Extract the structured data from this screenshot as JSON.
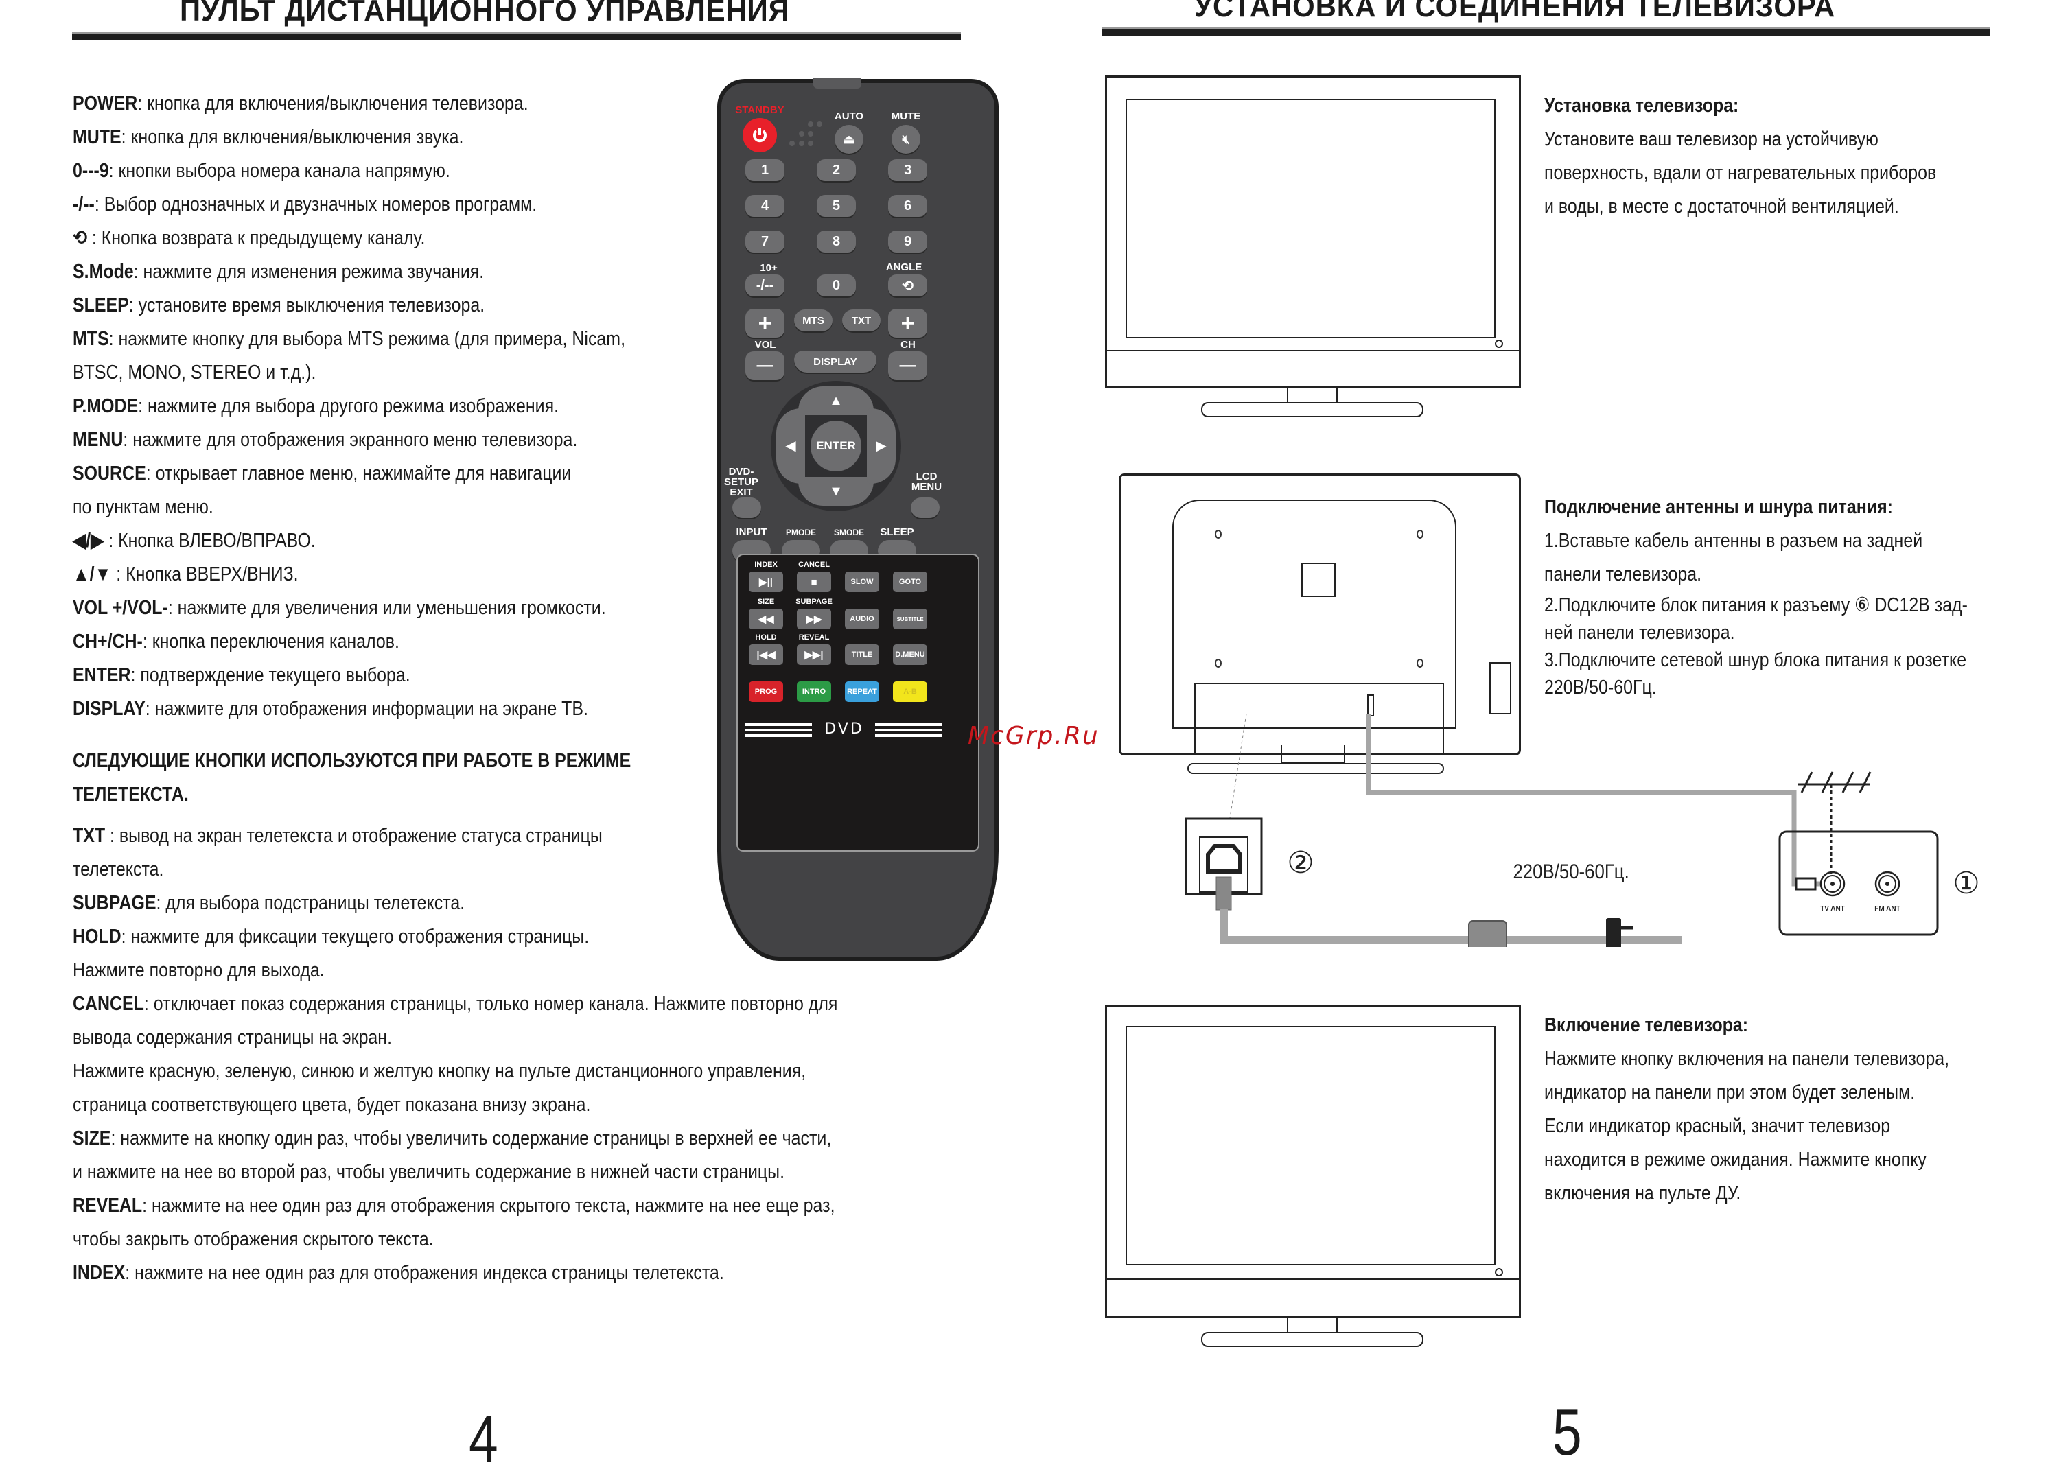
{
  "left_page": {
    "heading": "ПУЛЬТ ДИСТАНЦИОННОГО УПРАВЛЕНИЯ",
    "descriptions": [
      {
        "key": "POWER",
        "text": ": кнопка для включения/выключения телевизора."
      },
      {
        "key": "MUTE",
        "text": ": кнопка для включения/выключения звука."
      },
      {
        "key": "0---9",
        "text": ": кнопки выбора номера канала напрямую."
      },
      {
        "key": "-/--",
        "text": ": Выбор однозначных и двузначных номеров программ."
      },
      {
        "key": "⟲",
        "text": " : Кнопка возврата к предыдущему каналу."
      },
      {
        "key": "S.Mode",
        "text": ": нажмите для изменения режима звучания."
      },
      {
        "key": "SLEEP",
        "text": ": установите время выключения телевизора."
      },
      {
        "key": "MTS",
        "text": ": нажмите кнопку для выбора MTS режима (для примера, Nicam,"
      },
      {
        "key": "",
        "text": "BTSC, MONO, STEREO и т.д.)."
      },
      {
        "key": "P.MODE",
        "text": ": нажмите для выбора другого режима изображения."
      },
      {
        "key": "MENU",
        "text": ": нажмите для отображения экранного меню телевизора."
      },
      {
        "key": "SOURCE",
        "text": ": открывает главное меню, нажимайте для навигации"
      },
      {
        "key": "",
        "text": "по пунктам меню."
      },
      {
        "key": "◀/▶",
        "text": " : Кнопка ВЛЕВО/ВПРАВО."
      },
      {
        "key": "▲/▼",
        "text": " : Кнопка ВВЕРХ/ВНИЗ."
      },
      {
        "key": "VOL +/VOL-",
        "text": ": нажмите для увеличения или уменьшения громкости."
      },
      {
        "key": "CH+/CH-",
        "text": ": кнопка переключения каналов."
      },
      {
        "key": "ENTER",
        "text": ": подтверждение текущего выбора."
      },
      {
        "key": "DISPLAY",
        "text": ":  нажмите для отображения информации на экране ТВ."
      }
    ],
    "teletext_heading_1": "СЛЕДУЮЩИЕ КНОПКИ ИСПОЛЬЗУЮТСЯ ПРИ РАБОТЕ В РЕЖИМЕ",
    "teletext_heading_2": "ТЕЛЕТЕКСТА.",
    "teletext": [
      {
        "key": "TXT",
        "text": " : вывод на экран телетекста и отображение статуса страницы"
      },
      {
        "key": "",
        "text": "телетекста."
      },
      {
        "key": "SUBPAGE",
        "text": ": для выбора подстраницы телетекста."
      },
      {
        "key": "HOLD",
        "text": ": нажмите для фиксации текущего отображения страницы."
      },
      {
        "key": "",
        "text": "Нажмите повторно для выхода."
      },
      {
        "key": "CANCEL",
        "text": ": отключает показ содержания страницы, только номер канала. Нажмите повторно для"
      },
      {
        "key": "",
        "text": "вывода содержания страницы на экран."
      },
      {
        "key": "",
        "text": "Нажмите красную, зеленую, синюю и желтую кнопку на пульте дистанционного управления,"
      },
      {
        "key": "",
        "text": "страница соответствующего цвета, будет показана внизу экрана."
      },
      {
        "key": "SIZE",
        "text": ": нажмите на кнопку один раз, чтобы увеличить содержание страницы в верхней ее части,"
      },
      {
        "key": "",
        "text": "и нажмите на нее во второй раз, чтобы увеличить содержание в нижней части страницы."
      },
      {
        "key": "REVEAL",
        "text": ": нажмите на нее один раз для отображения скрытого текста, нажмите на нее еще раз,"
      },
      {
        "key": "",
        "text": "чтобы закрыть отображения скрытого текста."
      },
      {
        "key": "INDEX",
        "text": ": нажмите на нее один раз для отображения индекса страницы телетекста."
      }
    ],
    "page_number": "4"
  },
  "remote": {
    "standby_label": "STANDBY",
    "auto_label": "AUTO",
    "mute_label": "MUTE",
    "digits": [
      "1",
      "2",
      "3",
      "4",
      "5",
      "6",
      "7",
      "8",
      "9"
    ],
    "ten_plus_label": "10+",
    "dash_button": "-/--",
    "zero_button": "0",
    "angle_label": "ANGLE",
    "mts_button": "MTS",
    "txt_button": "TXT",
    "vol_label": "VOL",
    "ch_label": "CH",
    "plus": "+",
    "minus": "—",
    "display_button": "DISPLAY",
    "enter_button": "ENTER",
    "dvd_setup_label": "DVD-\nSETUP\nEXIT",
    "lcd_menu_label": "LCD\nMENU",
    "row_labels": [
      "INPUT",
      "PMODE",
      "SMODE",
      "SLEEP"
    ],
    "dvd_top_labels": [
      "INDEX",
      "CANCEL",
      "SIZE",
      "SUBPAGE",
      "HOLD",
      "REVEAL"
    ],
    "dvd_buttons": [
      "▶||",
      "■",
      "SLOW",
      "GOTO",
      "◀◀",
      "▶▶",
      "AUDIO",
      "SUBTITLE",
      "|◀◀",
      "▶▶|",
      "TITLE",
      "D.MENU"
    ],
    "color_buttons": [
      {
        "label": "PROG",
        "color": "#d8232a",
        "text_color": "#ffffff"
      },
      {
        "label": "INTRO",
        "color": "#2c9b46",
        "text_color": "#ffffff"
      },
      {
        "label": "REPEAT",
        "color": "#3aa0dc",
        "text_color": "#ffffff"
      },
      {
        "label": "A-B",
        "color": "#f2e51c",
        "text_color": "#d0c020"
      }
    ],
    "dvd_label": "DVD",
    "standby_color": "#e8202a"
  },
  "right_page": {
    "heading": "УСТАНОВКА И СОЕДИНЕНИЯ ТЕЛЕВИЗОРА",
    "section1": {
      "title": "Установка телевизора:",
      "lines": [
        "Установите ваш телевизор  на устойчивую",
        "поверхность, вдали от нагревательных приборов",
        "и воды, в месте с достаточной вентиляцией."
      ]
    },
    "section2": {
      "title": "Подключение антенны и шнура питания:",
      "lines": [
        "1.Вставьте кабель антенны в разъем на задней",
        "панели телевизора.",
        "2.Подключите блок питания к разъему ⑥  DC12В зад-",
        "ней панели телевизора.",
        "3.Подключите сетевой шнур блока питания к розетке",
        "220В/50-60Гц."
      ]
    },
    "diagram": {
      "voltage_label": "220В/50-60Гц.",
      "marker_1": "①",
      "marker_2": "②",
      "tv_ant_label": "TV ANT",
      "fm_ant_label": "FM ANT"
    },
    "section3": {
      "title": "Включение телевизора:",
      "lines": [
        "Нажмите кнопку включения на панели телевизора,",
        "индикатор на панели при этом будет зеленым.",
        "Если индикатор красный, значит телевизор",
        "находится в режиме ожидания. Нажмите кнопку",
        "включения на пульте ДУ."
      ]
    },
    "page_number": "5"
  },
  "watermark": "McGrp.Ru"
}
